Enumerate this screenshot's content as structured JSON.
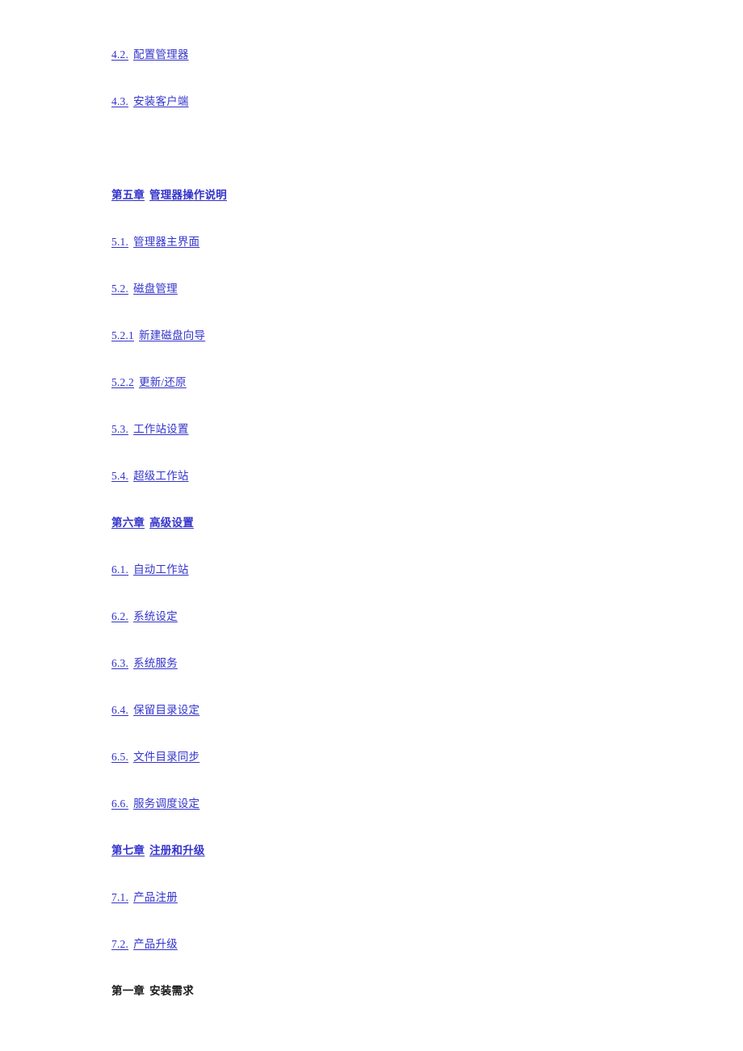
{
  "document": {
    "type": "table-of-contents",
    "link_color": "#3333CC",
    "heading_color": "#1A1A1A",
    "background_color": "#FFFFFF"
  },
  "toc": {
    "entries": [
      {
        "id": "e0",
        "number": "4.2.",
        "label": "配置管理器",
        "style": "link",
        "spacing": "first"
      },
      {
        "id": "e1",
        "number": "4.3.",
        "label": "安装客户端",
        "style": "link",
        "spacing": "normal"
      },
      {
        "id": "e2",
        "number": "第五章",
        "label": "管理器操作说明",
        "style": "chapter",
        "spacing": "large"
      },
      {
        "id": "e3",
        "number": "5.1.",
        "label": "管理器主界面",
        "style": "link",
        "spacing": "normal"
      },
      {
        "id": "e4",
        "number": "5.2.",
        "label": "磁盘管理",
        "style": "link",
        "spacing": "normal"
      },
      {
        "id": "e5",
        "number": "5.2.1",
        "label": "新建磁盘向导",
        "style": "link",
        "spacing": "normal"
      },
      {
        "id": "e6",
        "number": "5.2.2",
        "label": "更新/还原",
        "style": "link",
        "spacing": "normal"
      },
      {
        "id": "e7",
        "number": "5.3.",
        "label": "工作站设置",
        "style": "link",
        "spacing": "normal"
      },
      {
        "id": "e8",
        "number": "5.4.",
        "label": "超级工作站",
        "style": "link",
        "spacing": "normal"
      },
      {
        "id": "e9",
        "number": "第六章",
        "label": "高级设置",
        "style": "chapter",
        "spacing": "normal"
      },
      {
        "id": "e10",
        "number": "6.1.",
        "label": "自动工作站",
        "style": "link",
        "spacing": "normal"
      },
      {
        "id": "e11",
        "number": "6.2.",
        "label": "系统设定",
        "style": "link",
        "spacing": "normal"
      },
      {
        "id": "e12",
        "number": "6.3.",
        "label": "系统服务",
        "style": "link",
        "spacing": "normal"
      },
      {
        "id": "e13",
        "number": "6.4.",
        "label": "保留目录设定",
        "style": "link",
        "spacing": "normal"
      },
      {
        "id": "e14",
        "number": "6.5.",
        "label": "文件目录同步",
        "style": "link",
        "spacing": "normal"
      },
      {
        "id": "e15",
        "number": "6.6.",
        "label": "服务调度设定",
        "style": "link",
        "spacing": "normal"
      },
      {
        "id": "e16",
        "number": "第七章",
        "label": "注册和升级",
        "style": "chapter",
        "spacing": "normal"
      },
      {
        "id": "e17",
        "number": "7.1.",
        "label": "产品注册",
        "style": "link",
        "spacing": "normal"
      },
      {
        "id": "e18",
        "number": "7.2.",
        "label": "产品升级",
        "style": "link",
        "spacing": "normal"
      },
      {
        "id": "e19",
        "number": "第一章",
        "label": "安装需求",
        "style": "heading",
        "spacing": "normal"
      }
    ]
  }
}
